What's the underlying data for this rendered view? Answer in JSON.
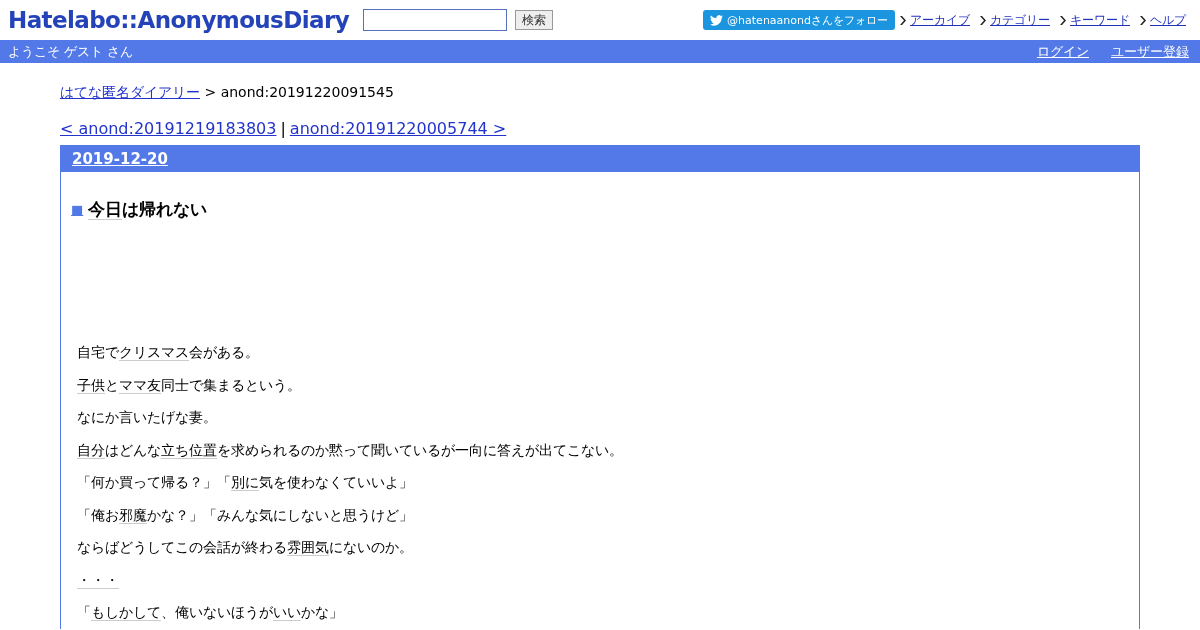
{
  "header": {
    "logo": "Hatelabo::AnonymousDiary",
    "search": {
      "button": "検索"
    },
    "follow_button": "@hatenaanondさんをフォロー",
    "nav": [
      "アーカイブ",
      "カテゴリー",
      "キーワード",
      "ヘルプ"
    ]
  },
  "userbar": {
    "welcome": "ようこそ ゲスト さん",
    "links": [
      "ログイン",
      "ユーザー登録"
    ]
  },
  "breadcrumb": {
    "link": "はてな匿名ダイアリー",
    "current": "> anond:20191220091545"
  },
  "pager": {
    "prev": "< anond:20191219183803",
    "separator": "|",
    "next": "anond:20191220005744 >"
  },
  "day": {
    "date": "2019-12-20",
    "title_mark": "■",
    "title": [
      {
        "text": "今日",
        "keyword": true
      },
      {
        "text": "は帰れない",
        "keyword": false
      }
    ],
    "paragraphs": [
      [
        {
          "text": "自宅で",
          "keyword": false
        },
        {
          "text": "クリスマス",
          "keyword": true
        },
        {
          "text": "会がある。",
          "keyword": false
        }
      ],
      [
        {
          "text": "子供",
          "keyword": true
        },
        {
          "text": "と",
          "keyword": false
        },
        {
          "text": "ママ友",
          "keyword": true
        },
        {
          "text": "同士で集まるという。",
          "keyword": false
        }
      ],
      [
        {
          "text": "なにか言いたげな妻。",
          "keyword": false
        }
      ],
      [
        {
          "text": "自分",
          "keyword": true
        },
        {
          "text": "はどんな",
          "keyword": false
        },
        {
          "text": "立ち位置",
          "keyword": true
        },
        {
          "text": "を求められるのか黙って聞いているが一向に答えが出てこない。",
          "keyword": false
        }
      ],
      [
        {
          "text": "「何か買って帰る？」「",
          "keyword": false
        },
        {
          "text": "別に",
          "keyword": true
        },
        {
          "text": "気を使わなくていいよ」",
          "keyword": false
        }
      ],
      [
        {
          "text": "「俺お",
          "keyword": false
        },
        {
          "text": "邪魔",
          "keyword": true
        },
        {
          "text": "かな？」「みんな気にしないと思うけど」",
          "keyword": false
        }
      ],
      [
        {
          "text": "ならばどうしてこの会話が終わる",
          "keyword": false
        },
        {
          "text": "雰囲気",
          "keyword": true
        },
        {
          "text": "にないのか。",
          "keyword": false
        }
      ],
      [
        {
          "text": "・・・",
          "keyword": true
        }
      ],
      [
        {
          "text": "「",
          "keyword": false
        },
        {
          "text": "もしかして",
          "keyword": true
        },
        {
          "text": "、俺いないほうが",
          "keyword": false
        },
        {
          "text": "いい",
          "keyword": true
        },
        {
          "text": "かな」",
          "keyword": false
        }
      ]
    ]
  }
}
